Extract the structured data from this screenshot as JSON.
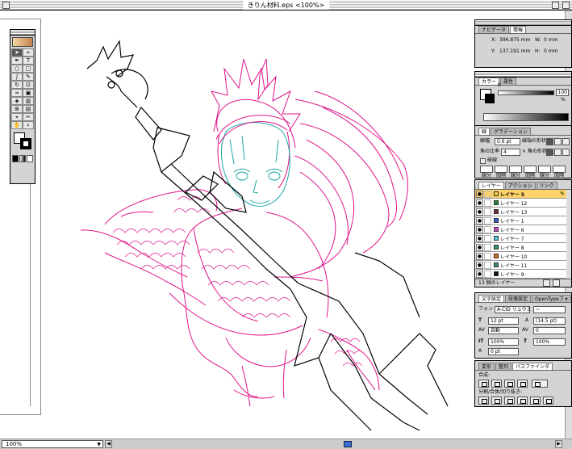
{
  "window": {
    "title": "きりん材料.eps <100%>",
    "zoom": "100%"
  },
  "colors": {
    "magenta": "#e0168a",
    "cyan": "#1ca7a7",
    "black": "#000000",
    "selected_layer": "#ffd36b",
    "scroll_thumb": "#3b6fd8"
  },
  "toolbox": {
    "tools": [
      "selection-tool",
      "direct-selection-tool",
      "pen-tool",
      "type-tool",
      "ellipse-tool",
      "rectangle-tool",
      "brush-tool",
      "pencil-tool",
      "rotate-tool",
      "scale-tool",
      "warp-tool",
      "free-transform-tool",
      "symbol-tool",
      "graph-tool",
      "mesh-tool",
      "gradient-tool",
      "eyedropper-tool",
      "scissors-tool",
      "hand-tool",
      "zoom-tool"
    ],
    "type_glyph": "T"
  },
  "navigator": {
    "tabs": [
      "ナビゲータ",
      "情報"
    ],
    "x_label": "X:",
    "x_value": "396.875 mm",
    "y_label": "Y:",
    "y_value": "137.191 mm",
    "w_label": "W:",
    "w_value": "0 mm",
    "h_label": "H:",
    "h_value": "0 mm"
  },
  "color": {
    "tabs": [
      "カラー",
      "属性"
    ],
    "channel": "K",
    "value": "100",
    "unit": "%"
  },
  "stroke": {
    "tabs": [
      "線",
      "グラデーション"
    ],
    "weight_label": "線幅",
    "weight_value": "0.6 pt",
    "cap_label": "線端の形状",
    "miter_label": "角の比率",
    "miter_value": "4",
    "join_label": "× 角の形状",
    "dash_label": "破線",
    "dash_fields": [
      "線分",
      "間隔",
      "線分",
      "間隔",
      "線分",
      "間隔"
    ]
  },
  "layers": {
    "tabs": [
      "レイヤー",
      "アクション",
      "リンク"
    ],
    "items": [
      {
        "name": "レイヤー 5",
        "color": "#f5c842",
        "selected": true
      },
      {
        "name": "レイヤー 12",
        "color": "#1a8a3a"
      },
      {
        "name": "レイヤー 13",
        "color": "#7a2a2a"
      },
      {
        "name": "レイヤー 1",
        "color": "#3a5ad6"
      },
      {
        "name": "レイヤー 6",
        "color": "#d04ad0"
      },
      {
        "name": "レイヤー 7",
        "color": "#4ac8d8"
      },
      {
        "name": "レイヤー 8",
        "color": "#2a9a5a"
      },
      {
        "name": "レイヤー 10",
        "color": "#d86a1a"
      },
      {
        "name": "レイヤー 11",
        "color": "#3a8a8a"
      },
      {
        "name": "レイヤー 9",
        "color": "#111111"
      }
    ],
    "footer": "13 個のレイヤー"
  },
  "character": {
    "tabs": [
      "文字設定",
      "段落設定",
      "OpenTypeフォント設定"
    ],
    "font_label": "フォント:",
    "font_value": "A-CID リュウミ",
    "style_value": "~",
    "size": "12 pt",
    "leading": "(14.5 pt)",
    "tracking": "自動",
    "kerning": "0",
    "vscale": "100%",
    "hscale": "100%",
    "baseline": "0 pt"
  },
  "pathfinder": {
    "tabs": [
      "変形",
      "整列",
      "パスファインダ"
    ],
    "shape_label": "合成:",
    "divide_label": "分割/合体/切り抜き:"
  }
}
